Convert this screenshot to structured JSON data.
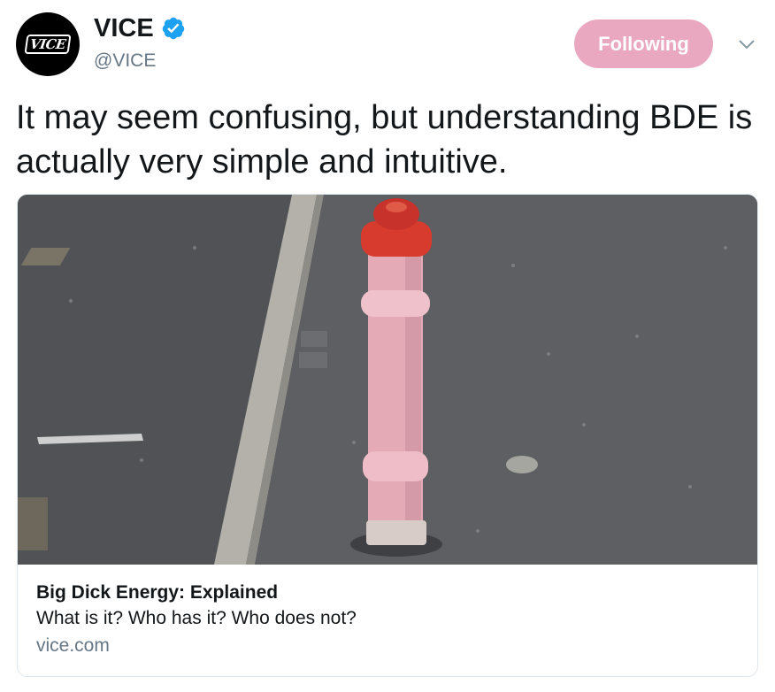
{
  "author": {
    "name": "VICE",
    "handle": "@VICE",
    "verified": true,
    "avatar_logo": "VICE"
  },
  "follow_button": {
    "label": "Following",
    "color": "#e9a8bf"
  },
  "tweet": {
    "text": "It may seem confusing, but understanding BDE is actually very simple and intuitive."
  },
  "card": {
    "image": "photo of a pink and red metal bollard on an asphalt sidewalk next to a curb",
    "title": "Big Dick Energy: Explained",
    "description": "What is it? Who has it? Who does not?",
    "domain": "vice.com"
  },
  "icons": [
    "verified-badge-icon",
    "chevron-down-icon"
  ],
  "colors": {
    "verified": "#1da1f2",
    "muted": "#657786",
    "text": "#14171a"
  }
}
